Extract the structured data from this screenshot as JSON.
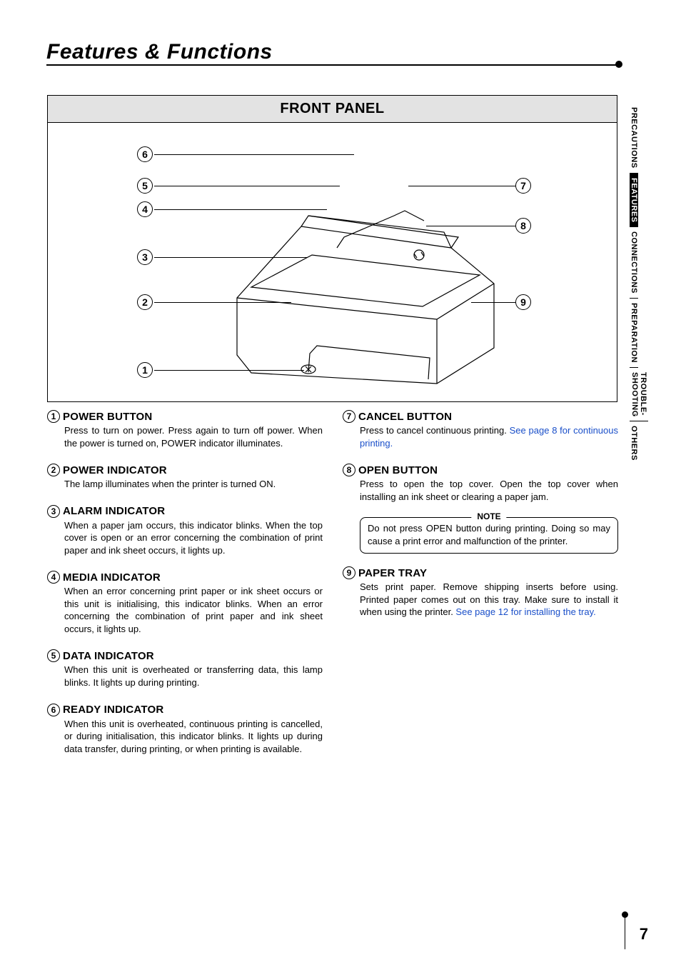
{
  "page": {
    "title": "Features & Functions",
    "number": "7"
  },
  "panel": {
    "heading": "FRONT PANEL"
  },
  "callouts": {
    "left": [
      "1",
      "2",
      "3",
      "4",
      "5",
      "6"
    ],
    "right": [
      "7",
      "8",
      "9"
    ]
  },
  "items_left": [
    {
      "num": "1",
      "title": "POWER BUTTON",
      "body": "Press to turn on power.  Press again to turn off power. When the power is turned on, POWER indicator illuminates."
    },
    {
      "num": "2",
      "title": "POWER INDICATOR",
      "body": "The lamp illuminates when the printer is turned ON."
    },
    {
      "num": "3",
      "title": "ALARM INDICATOR",
      "body": "When a paper jam occurs, this indicator blinks. When the top cover is open or an error concerning the combination of print paper and ink sheet occurs, it lights up."
    },
    {
      "num": "4",
      "title": "MEDIA INDICATOR",
      "body": "When an error concerning print paper or ink sheet occurs or this unit is initialising, this indicator blinks.  When an error concerning the combination of print paper and ink sheet occurs, it lights up."
    },
    {
      "num": "5",
      "title": "DATA INDICATOR",
      "body": "When this unit is overheated or transferring data, this lamp blinks. It lights up during printing."
    },
    {
      "num": "6",
      "title": "READY INDICATOR",
      "body": "When this unit is overheated, continuous printing is cancelled, or during initialisation, this indicator blinks. It lights up during data transfer, during printing, or when printing is available."
    }
  ],
  "items_right": [
    {
      "num": "7",
      "title": "CANCEL BUTTON",
      "body_pre": "Press to cancel continuous printing. ",
      "link": "See page 8 for continuous printing."
    },
    {
      "num": "8",
      "title": "OPEN BUTTON",
      "body": "Press to open the top cover. Open the top cover when installing an ink sheet or clearing a paper jam."
    },
    {
      "num": "9",
      "title": "PAPER TRAY",
      "body_pre": "Sets print paper. Remove shipping inserts before using. Printed paper comes out on this tray. Make sure to install it when using the printer. ",
      "link": "See page 12 for installing the tray."
    }
  ],
  "note": {
    "label": "NOTE",
    "text": "Do not press OPEN button during printing. Doing so may cause a print error and malfunction of the printer."
  },
  "tabs": [
    {
      "label": "PRECAUTIONS",
      "active": false
    },
    {
      "label": "FEATURES",
      "active": true
    },
    {
      "label": "CONNECTIONS",
      "active": false
    },
    {
      "label": "PREPARATION",
      "active": false
    },
    {
      "line1": "TROUBLE-",
      "line2": "SHOOTING",
      "active": false,
      "multi": true
    },
    {
      "label": "OTHERS",
      "active": false
    }
  ]
}
